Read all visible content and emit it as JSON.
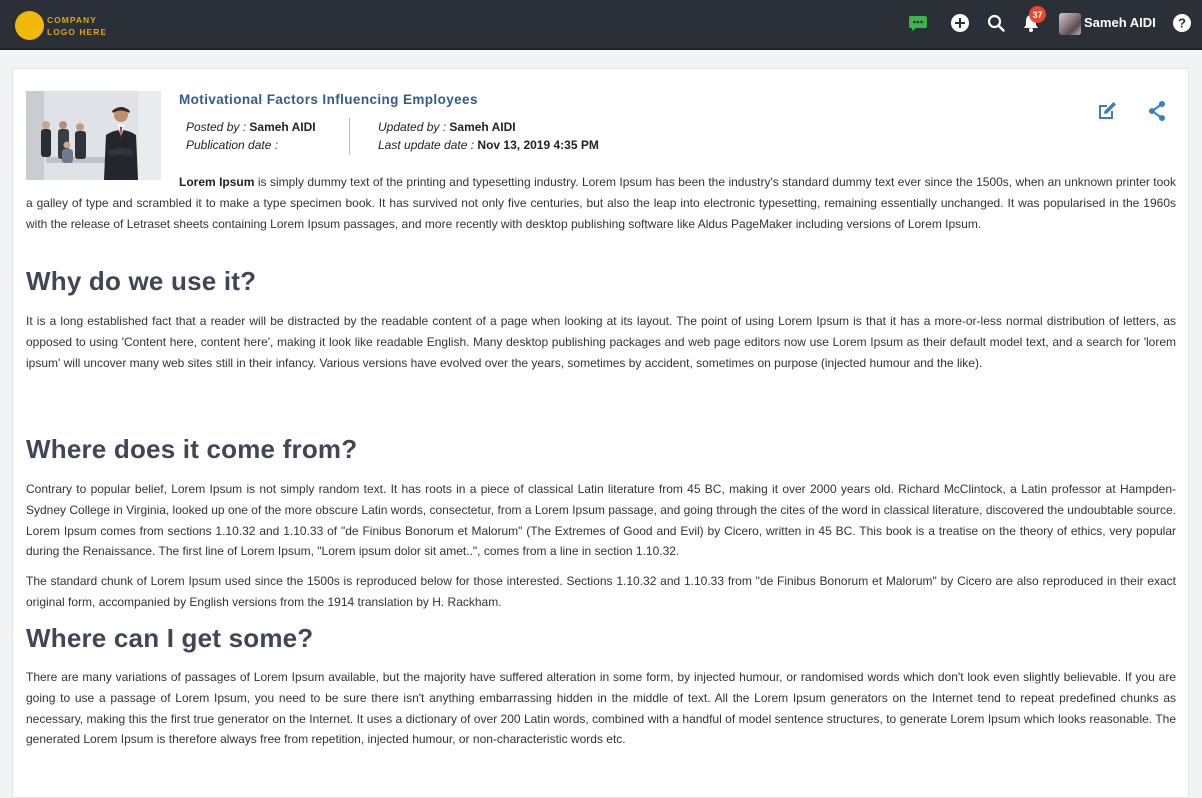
{
  "header": {
    "logo": {
      "line1": "COMPANY",
      "line2": "LOGO HERE"
    },
    "icons": [
      "chat-icon",
      "add-icon",
      "search-icon",
      "bell-icon",
      "help-icon"
    ],
    "notification_count": "37",
    "user_name": "Sameh AIDI"
  },
  "post": {
    "title": "Motivational Factors Influencing Employees",
    "posted_by_label": "Posted by :",
    "posted_by": "Sameh AIDI",
    "publication_label": "Publication date :",
    "publication_date": "",
    "updated_by_label": "Updated by :",
    "updated_by": "Sameh AIDI",
    "last_update_label": "Last update date :",
    "last_update_date": "Nov 13, 2019 4:35 PM",
    "intro_bold": "Lorem Ipsum",
    "intro_rest": " is simply dummy text of the printing and typesetting industry. Lorem Ipsum has been the industry's standard dummy text ever since the 1500s, when an unknown printer took a galley of type and scrambled it to make a type specimen book. It has survived not only five centuries, but also the leap into electronic typesetting, remaining essentially unchanged. It was popularised in the 1960s with the release of Letraset sheets containing Lorem Ipsum passages, and more recently with desktop publishing software like Aldus PageMaker including versions of Lorem Ipsum."
  },
  "sections": [
    {
      "heading": "Why do we use it?",
      "paragraphs": [
        "It is a long established fact that a reader will be distracted by the readable content of a page when looking at its layout. The point of using Lorem Ipsum is that it has a more-or-less normal distribution of letters, as opposed to using 'Content here, content here', making it look like readable English. Many desktop publishing packages and web page editors now use Lorem Ipsum as their default model text, and a search for 'lorem ipsum' will uncover many web sites still in their infancy. Various versions have evolved over the years, sometimes by accident, sometimes on purpose (injected humour and the like)."
      ]
    },
    {
      "heading": "Where does it come from?",
      "paragraphs": [
        "Contrary to popular belief, Lorem Ipsum is not simply random text. It has roots in a piece of classical Latin literature from 45 BC, making it over 2000 years old. Richard McClintock, a Latin professor at Hampden-Sydney College in Virginia, looked up one of the more obscure Latin words, consectetur, from a Lorem Ipsum passage, and going through the cites of the word in classical literature, discovered the undoubtable source. Lorem Ipsum comes from sections 1.10.32 and 1.10.33 of \"de Finibus Bonorum et Malorum\" (The Extremes of Good and Evil) by Cicero, written in 45 BC. This book is a treatise on the theory of ethics, very popular during the Renaissance. The first line of Lorem Ipsum, \"Lorem ipsum dolor sit amet..\", comes from a line in section 1.10.32.",
        "The standard chunk of Lorem Ipsum used since the 1500s is reproduced below for those interested. Sections 1.10.32 and 1.10.33 from \"de Finibus Bonorum et Malorum\" by Cicero are also reproduced in their exact original form, accompanied by English versions from the 1914 translation by H. Rackham."
      ]
    },
    {
      "heading": "Where can I get some?",
      "paragraphs": [
        "There are many variations of passages of Lorem Ipsum available, but the majority have suffered alteration in some form, by injected humour, or randomised words which don't look even slightly believable. If you are going to use a passage of Lorem Ipsum, you need to be sure there isn't anything embarrassing hidden in the middle of text. All the Lorem Ipsum generators on the Internet tend to repeat predefined chunks as necessary, making this the first true generator on the Internet. It uses a dictionary of over 200 Latin words, combined with a handful of model sentence structures, to generate Lorem Ipsum which looks reasonable. The generated Lorem Ipsum is therefore always free from repetition, injected humour, or non-characteristic words etc."
      ]
    }
  ],
  "colors": {
    "topbar": "#2b2f38",
    "logo_accent": "#f2b807",
    "title_blue": "#2f5d8c",
    "icon_blue": "#3f7fb7",
    "chat_green": "#3bb54a",
    "badge_red": "#e8472d",
    "heading_gray": "#404656"
  }
}
